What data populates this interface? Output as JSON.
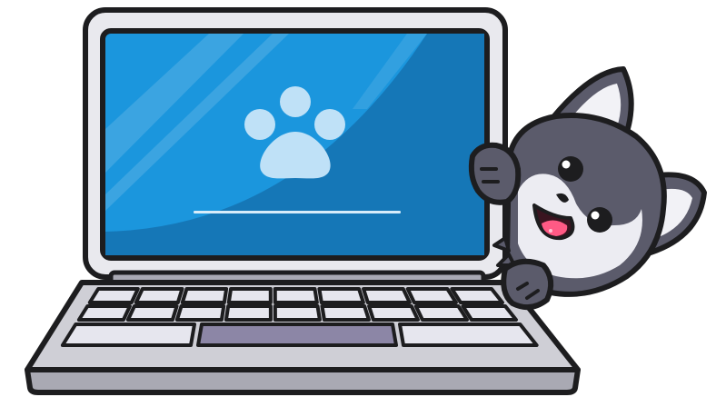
{
  "illustration": {
    "subject": "cartoon-cat-peeking-from-laptop",
    "laptop": {
      "screen_icon": "paw-icon",
      "loading_progress": 1.0,
      "colors": {
        "outline": "#1d1d1f",
        "lid": "#e9e9ee",
        "screen": "#1b96dd",
        "screen_dark": "#1577b7",
        "paw": "#bfe1f7",
        "base": "#cfcfd6",
        "base_shadow": "#a9a9b3",
        "keys": "#e6e6ee",
        "trackpad": "#8c86a6"
      }
    },
    "cat": {
      "colors": {
        "fur": "#5b5b6b",
        "fur_dark": "#464654",
        "face_light": "#ececf2",
        "inner_ear": "#f2f2f6",
        "tongue": "#ff5a85",
        "eye": "#1d1d1f"
      }
    }
  }
}
